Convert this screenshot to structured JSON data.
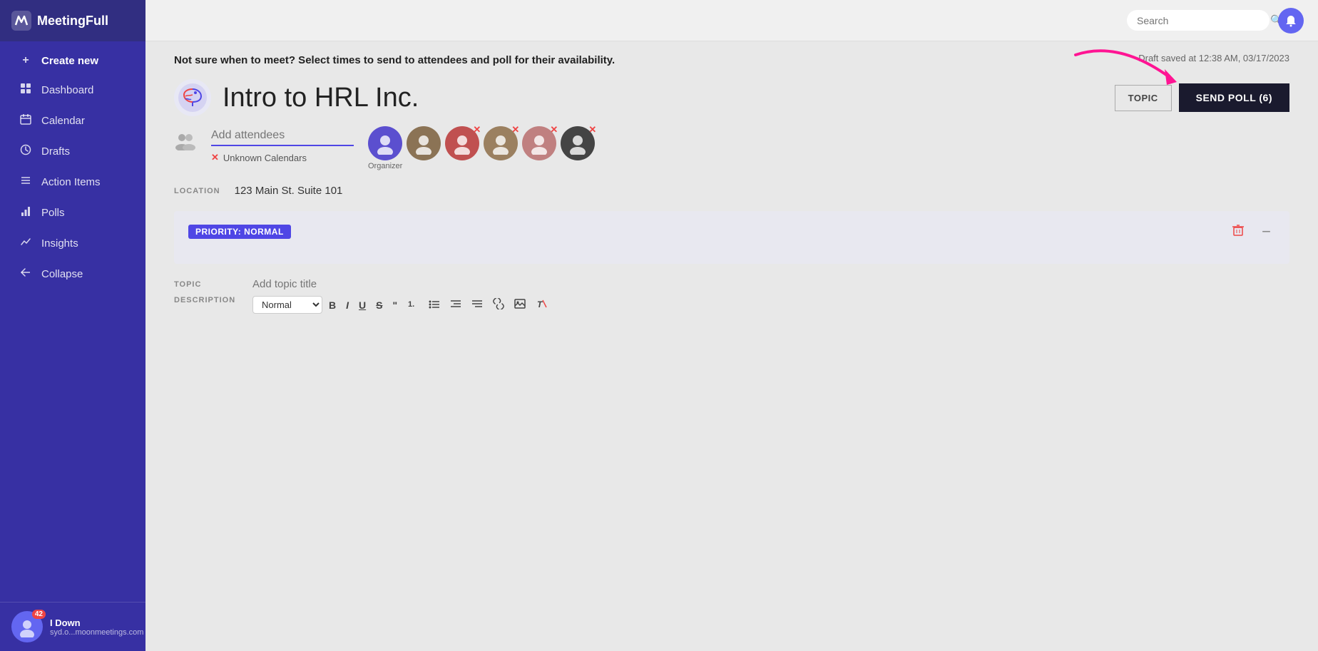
{
  "sidebar": {
    "logo": "MeetingFull",
    "logo_icon": "M",
    "items": [
      {
        "id": "create-new",
        "label": "Create new",
        "icon": "+"
      },
      {
        "id": "dashboard",
        "label": "Dashboard",
        "icon": "⊞"
      },
      {
        "id": "calendar",
        "label": "Calendar",
        "icon": "📅"
      },
      {
        "id": "drafts",
        "label": "Drafts",
        "icon": "🕐"
      },
      {
        "id": "action-items",
        "label": "Action Items",
        "icon": "≡"
      },
      {
        "id": "polls",
        "label": "Polls",
        "icon": "🗃"
      },
      {
        "id": "insights",
        "label": "Insights",
        "icon": "📊"
      },
      {
        "id": "collapse",
        "label": "Collapse",
        "icon": "←"
      }
    ],
    "user": {
      "name": "I Down",
      "email": "syd.o...moonmeetings.com",
      "badge": "42"
    }
  },
  "topbar": {
    "search_placeholder": "Search",
    "search_value": "Search"
  },
  "main": {
    "info_banner": "Not sure when to meet? Select times to send to attendees and poll for their availability.",
    "draft_saved": "Draft saved at 12:38 AM, 03/17/2023",
    "meeting_title": "Intro to HRL Inc.",
    "send_poll_label": "SEND POLL (6)",
    "topic_button_label": "TOPIC",
    "attendees_placeholder": "Add attendees",
    "unknown_calendars": "Unknown Calendars",
    "location_label": "LOCATION",
    "location_value": "123 Main St. Suite 101",
    "priority_badge": "PRIORITY: NORMAL",
    "topic_label": "TOPIC",
    "topic_placeholder": "Add topic title",
    "description_label": "DESCRIPTION",
    "desc_select_value": "Normal",
    "organizer_label": "Organizer",
    "attendees": [
      {
        "id": "att-1",
        "color": "#5b4fcf",
        "initial": "👤",
        "is_organizer": true
      },
      {
        "id": "att-2",
        "color": "#8b7355",
        "initial": "👤",
        "is_organizer": false
      },
      {
        "id": "att-3",
        "color": "#c05050",
        "initial": "👤",
        "is_organizer": false
      },
      {
        "id": "att-4",
        "color": "#9b8060",
        "initial": "👤",
        "is_organizer": false
      },
      {
        "id": "att-5",
        "color": "#c08080",
        "initial": "👤",
        "is_organizer": false
      },
      {
        "id": "att-6",
        "color": "#444",
        "initial": "👤",
        "is_organizer": false
      }
    ]
  }
}
